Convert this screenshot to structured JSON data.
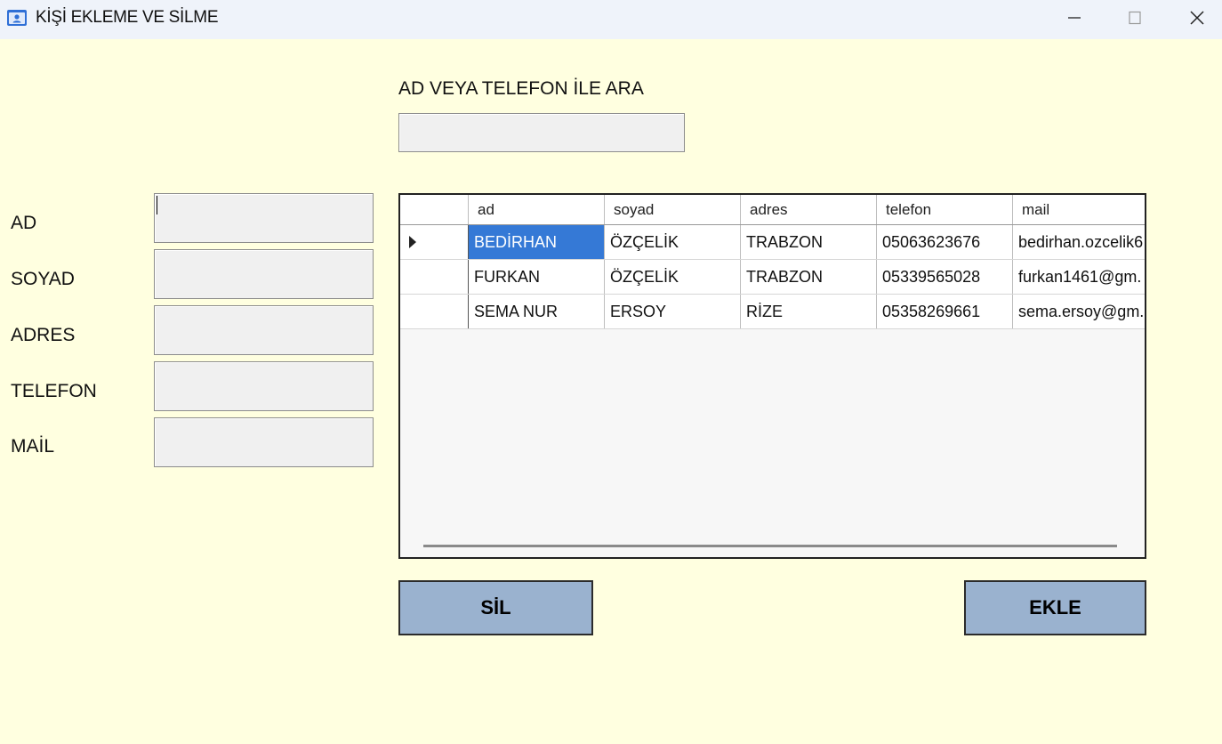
{
  "window": {
    "title": "KİŞİ EKLEME VE SİLME"
  },
  "search": {
    "label": "AD VEYA TELEFON İLE ARA",
    "value": ""
  },
  "form": {
    "fields": [
      {
        "label": "AD",
        "value": ""
      },
      {
        "label": "SOYAD",
        "value": ""
      },
      {
        "label": "ADRES",
        "value": ""
      },
      {
        "label": "TELEFON",
        "value": ""
      },
      {
        "label": "MAİL",
        "value": ""
      }
    ]
  },
  "grid": {
    "columns": [
      "ad",
      "soyad",
      "adres",
      "telefon",
      "mail"
    ],
    "rows": [
      [
        "BEDİRHAN",
        "ÖZÇELİK",
        "TRABZON",
        "05063623676",
        "bedirhan.ozcelik6..."
      ],
      [
        "FURKAN",
        "ÖZÇELİK",
        "TRABZON",
        "05339565028",
        "furkan1461@gm..."
      ],
      [
        "SEMA NUR",
        "ERSOY",
        "RİZE",
        "05358269661",
        "sema.ersoy@gm...."
      ]
    ],
    "selection_color": "#3579d6"
  },
  "buttons": {
    "delete": "SİL",
    "add": "EKLE"
  },
  "colors": {
    "background": "#ffffe0",
    "button": "#9ab2cf"
  }
}
